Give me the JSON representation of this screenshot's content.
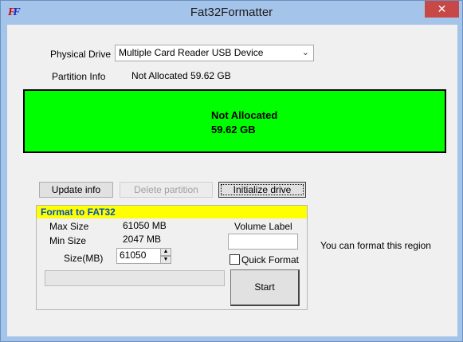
{
  "window": {
    "title": "Fat32Formatter",
    "close_glyph": "✕"
  },
  "drive": {
    "physical_drive_label": "Physical Drive",
    "selected_drive": "Multiple Card  Reader USB Device",
    "partition_info_label": "Partition Info",
    "partition_info_value": "Not Allocated  59.62 GB"
  },
  "partition_bar": {
    "line1": "Not Allocated",
    "line2": "59.62 GB",
    "color": "#00ff00"
  },
  "actions": {
    "update_info": "Update info",
    "delete_partition": "Delete partition",
    "initialize_drive": "Initialize drive"
  },
  "format_group": {
    "title": "Format to FAT32",
    "max_size_label": "Max Size",
    "max_size_value": "61050 MB",
    "min_size_label": "Min Size",
    "min_size_value": "2047 MB",
    "size_label": "Size(MB)",
    "size_value": "61050",
    "volume_label_label": "Volume Label",
    "volume_label_value": "",
    "quick_format_label": "Quick Format",
    "quick_format_checked": false,
    "start_label": "Start",
    "progress": 0
  },
  "hint": "You can format this region",
  "icons": {
    "app": "fat32-app-icon",
    "close": "close-icon",
    "dropdown": "chevron-down-icon",
    "spin_up": "spin-up-icon",
    "spin_down": "spin-down-icon"
  }
}
